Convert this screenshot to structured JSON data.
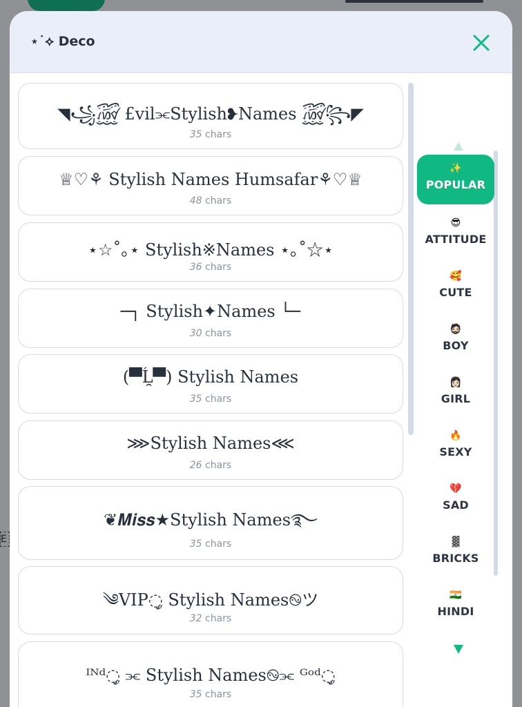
{
  "header": {
    "title": "⋆˙⟡ Deco",
    "close_icon": "close-icon",
    "accent": "#10b981"
  },
  "list": {
    "cards": [
      {
        "name": "◥꧁꫞ £vil⫘Stylish❥Names ꫞꧂◤",
        "count": "35",
        "unit": "chars"
      },
      {
        "name": "♕♡⚘ Stylish Names Humsafar⚘♡♕",
        "count": "48",
        "unit": "chars"
      },
      {
        "name": "⋆☆˚｡⋆ Stylish※Names ⋆｡˚☆⋆",
        "count": "36",
        "unit": "chars"
      },
      {
        "name": "─┐  Stylish✦Names  └─",
        "count": "30",
        "unit": "chars"
      },
      {
        "name": "(▀̿Ĺ̯▀̿) Stylish Names",
        "count": "35",
        "unit": "chars"
      },
      {
        "name": "⋙Stylish Names⋘",
        "count": "26",
        "unit": "chars"
      },
      {
        "name": "❦𝑴𝒊𝒔𝒔★Stylish Names࿐",
        "count": "35",
        "unit": "chars"
      },
      {
        "name": "༄VIP◌ᤢ Stylish Names࿊ツ",
        "count": "32",
        "unit": "chars"
      },
      {
        "name": "ᴵᴺᵈ◌ᤢ ⫘ Stylish Names࿊⫘ ᴳᵒᵈ◌ᤢ",
        "count": "35",
        "unit": "chars"
      }
    ]
  },
  "rail": {
    "up_icon": "chevron-up-icon",
    "down_icon": "chevron-down-icon",
    "items": [
      {
        "emoji": "✨",
        "label": "POPULAR",
        "active": true
      },
      {
        "emoji": "😎",
        "label": "ATTITUDE"
      },
      {
        "emoji": "🥰",
        "label": "CUTE"
      },
      {
        "emoji": "🧔🏻",
        "label": "BOY"
      },
      {
        "emoji": "👩🏻",
        "label": "GIRL"
      },
      {
        "emoji": "🔥",
        "label": "SEXY"
      },
      {
        "emoji": "💔",
        "label": "SAD"
      },
      {
        "emoji": "▓",
        "label": "BRICKS"
      },
      {
        "emoji": "🇮🇳",
        "label": "HINDI"
      }
    ]
  },
  "backdrop": {
    "stub_text": "E"
  }
}
